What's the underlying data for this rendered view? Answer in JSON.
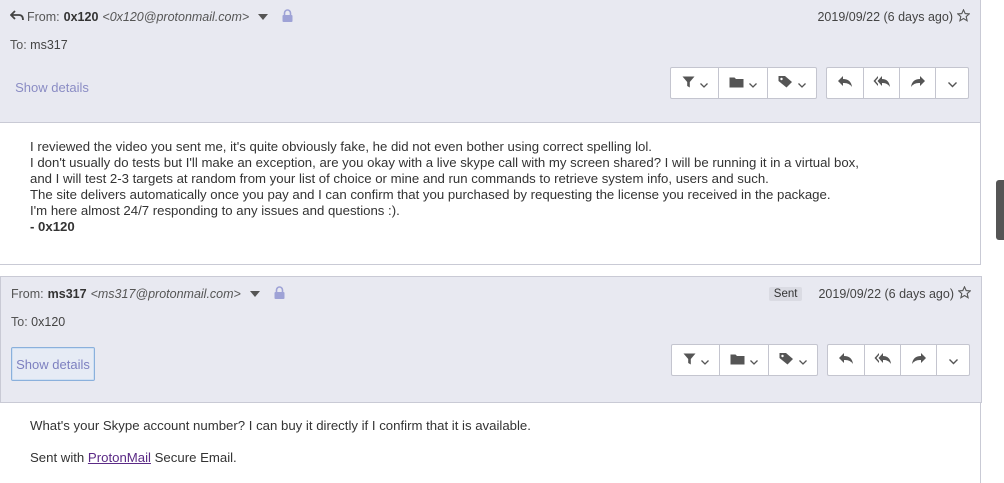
{
  "messages": [
    {
      "from_label": "From:",
      "from_name": "0x120",
      "from_address": "<0x120@protonmail.com>",
      "date": "2019/09/22 (6 days ago)",
      "to_label": "To:",
      "to_value": "ms317",
      "show_details": "Show details",
      "body_lines": [
        "I reviewed the video you sent me, it's quite obviously fake, he did not even bother using correct spelling lol.",
        "I don't usually do tests but I'll make an exception, are you okay with a live skype call with my screen shared? I will be running it in a virtual box,",
        "and I will test 2-3 targets at random from your list of choice or mine and run commands to retrieve system info, users and such.",
        "The site delivers automatically once you pay and I can confirm that you purchased by requesting the license you received in the package.",
        "I'm here almost 24/7 responding to any issues and questions :)."
      ],
      "signature": "- 0x120"
    },
    {
      "from_label": "From:",
      "from_name": "ms317",
      "from_address": "<ms317@protonmail.com>",
      "badge": "Sent",
      "date": "2019/09/22 (6 days ago)",
      "to_label": "To:",
      "to_value": "0x120",
      "show_details": "Show details",
      "body_line": "What's your Skype account number? I can buy it directly if I confirm that it is available.",
      "footer_prefix": "Sent with ",
      "footer_link": "ProtonMail",
      "footer_suffix": " Secure Email."
    }
  ],
  "icons": {
    "reply_arrow": "reply-arrow-icon",
    "caret": "caret-down-icon",
    "lock": "lock-icon",
    "star": "star-outline-icon",
    "filter": "filter-icon",
    "folder": "folder-icon",
    "label": "tag-icon",
    "reply": "reply-icon",
    "reply_all": "reply-all-icon",
    "forward": "forward-icon",
    "more": "chevron-down-icon"
  },
  "colors": {
    "header_bg": "#e8e9f1",
    "accent_link": "#8a8cc4",
    "lock": "#9ea2d6",
    "signature_link": "#5b2a86"
  }
}
